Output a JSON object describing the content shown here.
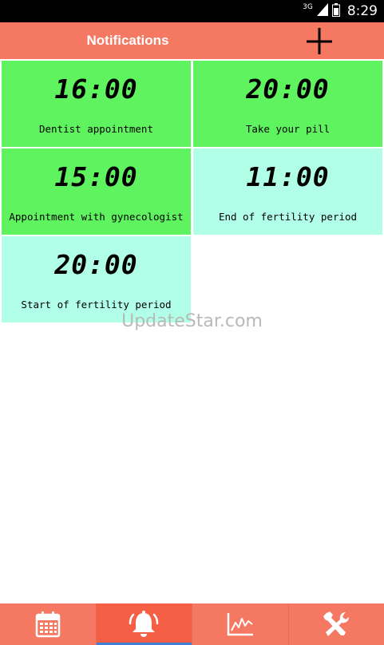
{
  "status_bar": {
    "network": "3G",
    "time": "8:29"
  },
  "app_bar": {
    "title": "Notifications",
    "add_icon": "plus-icon"
  },
  "notifications": [
    {
      "time": "16:00",
      "label": "Dentist appointment",
      "color": "#5ff360"
    },
    {
      "time": "20:00",
      "label": "Take your pill",
      "color": "#5ff360"
    },
    {
      "time": "15:00",
      "label": "Appointment with gynecologist",
      "color": "#5ff360"
    },
    {
      "time": "11:00",
      "label": "End of fertility period",
      "color": "#b2ffe8"
    },
    {
      "time": "20:00",
      "label": "Start of fertility period",
      "color": "#b2ffe8"
    }
  ],
  "watermark": "UpdateStar.com",
  "bottom_nav": {
    "items": [
      {
        "icon": "calendar-icon",
        "active": false
      },
      {
        "icon": "bell-icon",
        "active": true
      },
      {
        "icon": "chart-icon",
        "active": false
      },
      {
        "icon": "tools-icon",
        "active": false
      }
    ]
  },
  "colors": {
    "accent": "#f47862",
    "active_indicator": "#3f7fd8"
  }
}
